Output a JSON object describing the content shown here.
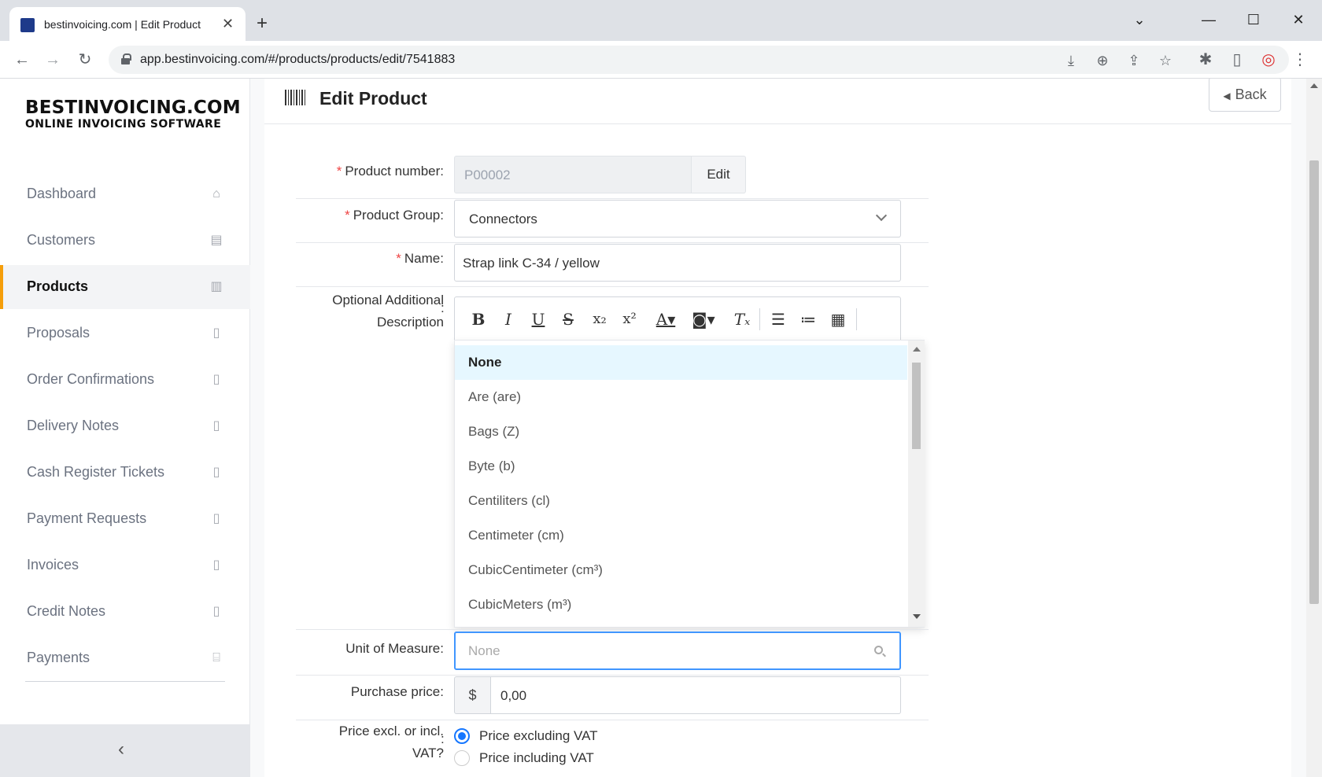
{
  "browser": {
    "tab_title": "bestinvoicing.com | Edit Product",
    "url": "app.bestinvoicing.com/#/products/products/edit/7541883"
  },
  "brand": {
    "line1": "BESTINVOICING.COM",
    "line2": "ONLINE INVOICING SOFTWARE",
    "accent_color": "#f59e0b"
  },
  "sidebar": {
    "items": [
      {
        "label": "Dashboard",
        "icon": "home-icon"
      },
      {
        "label": "Customers",
        "icon": "contact-book-icon"
      },
      {
        "label": "Products",
        "icon": "barcode-icon",
        "active": true
      },
      {
        "label": "Proposals",
        "icon": "pdf-file-icon"
      },
      {
        "label": "Order Confirmations",
        "icon": "pdf-file-icon"
      },
      {
        "label": "Delivery Notes",
        "icon": "pdf-file-icon"
      },
      {
        "label": "Cash Register Tickets",
        "icon": "pdf-file-icon"
      },
      {
        "label": "Payment Requests",
        "icon": "pdf-file-icon"
      },
      {
        "label": "Invoices",
        "icon": "pdf-file-icon"
      },
      {
        "label": "Credit Notes",
        "icon": "pdf-file-icon"
      },
      {
        "label": "Payments",
        "icon": "bank-icon"
      }
    ],
    "collapse_glyph": "‹"
  },
  "header": {
    "title": "Edit Product",
    "back_label": "Back"
  },
  "form": {
    "product_number": {
      "label": "Product number",
      "value": "P00002",
      "edit_label": "Edit"
    },
    "product_group": {
      "label": "Product Group",
      "value": "Connectors"
    },
    "name": {
      "label": "Name",
      "value": "Strap link C-34 / yellow"
    },
    "description": {
      "label_line1": "Optional Additional",
      "label_line2": "Description"
    },
    "unit_of_measure": {
      "label": "Unit of Measure",
      "placeholder": "None"
    },
    "purchase_price": {
      "label": "Purchase price",
      "currency": "$",
      "value": "0,00"
    },
    "vat": {
      "label_line1": "Price excl. or incl.",
      "label_line2": "VAT?",
      "options": [
        {
          "label": "Price excluding VAT",
          "checked": true
        },
        {
          "label": "Price including VAT",
          "checked": false
        }
      ]
    },
    "colon": ":",
    "required_mark": "*"
  },
  "uom_dropdown": {
    "options": [
      "None",
      "Are (are)",
      "Bags (Z)",
      "Byte (b)",
      "Centiliters (cl)",
      "Centimeter (cm)",
      "CubicCentimeter (cm³)",
      "CubicMeters (m³)"
    ],
    "selected": "None"
  }
}
